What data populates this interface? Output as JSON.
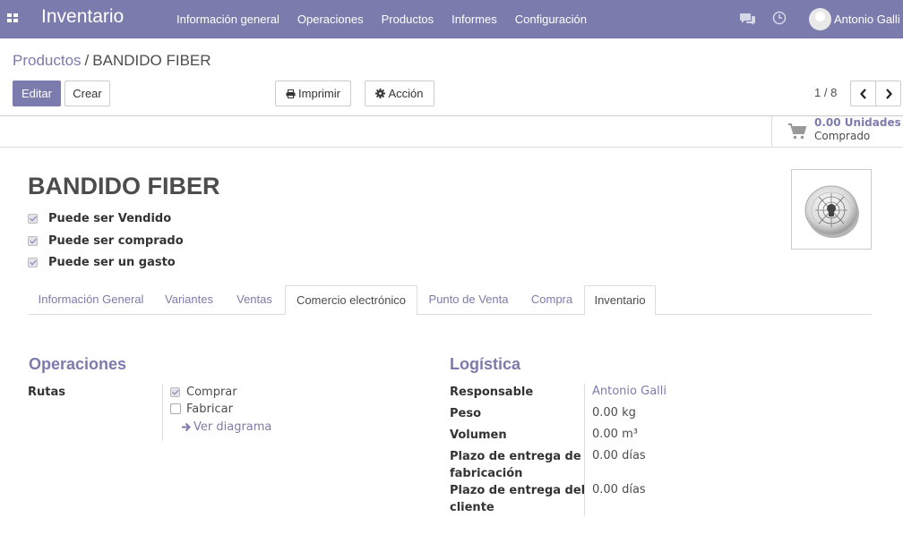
{
  "app": {
    "title": "Inventario"
  },
  "menu": [
    "Información general",
    "Operaciones",
    "Productos",
    "Informes",
    "Configuración"
  ],
  "user": {
    "name": "Antonio Galli"
  },
  "breadcrumb": {
    "parent": "Productos",
    "separator": "/",
    "current": "BANDIDO FIBER"
  },
  "buttons": {
    "edit": "Editar",
    "create": "Crear",
    "print": "Imprimir",
    "action": "Acción"
  },
  "pager": {
    "value": "1 / 8"
  },
  "stat": {
    "value": "0.00 Unidades",
    "label": "Comprado"
  },
  "product": {
    "name": "BANDIDO FIBER",
    "checks": [
      {
        "label": "Puede ser Vendido",
        "checked": true
      },
      {
        "label": "Puede ser comprado",
        "checked": true
      },
      {
        "label": "Puede ser un gasto",
        "checked": true
      }
    ]
  },
  "tabs": [
    "Información General",
    "Variantes",
    "Ventas",
    "Comercio electrónico",
    "Punto de Venta",
    "Compra",
    "Inventario"
  ],
  "active_tab": "Inventario",
  "operaciones": {
    "title": "Operaciones",
    "rutas_label": "Rutas",
    "routes": [
      {
        "label": "Comprar",
        "checked": true
      },
      {
        "label": "Fabricar",
        "checked": false
      }
    ],
    "diagram_link": "Ver diagrama"
  },
  "logistica": {
    "title": "Logística",
    "fields": {
      "responsable": {
        "label": "Responsable",
        "value": "Antonio Galli"
      },
      "peso": {
        "label": "Peso",
        "value": "0.00 kg"
      },
      "volumen": {
        "label": "Volumen",
        "value": "0.00 m³"
      },
      "plazo_fab": {
        "label1": "Plazo de entrega de",
        "label2": "fabricación",
        "value": "0.00 días"
      },
      "plazo_cli": {
        "label1": "Plazo de entrega del",
        "label2": "cliente",
        "value": "0.00 días"
      }
    }
  },
  "colors": {
    "brand": "#7c7bad",
    "text": "#4c4c4c"
  }
}
